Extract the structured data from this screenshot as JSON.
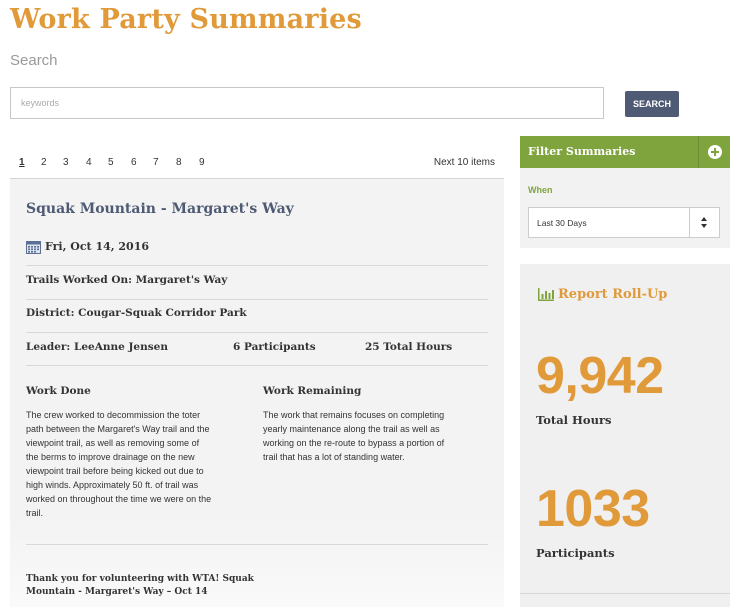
{
  "header": {
    "title": "Work Party Summaries"
  },
  "search": {
    "label": "Search",
    "placeholder": "keywords",
    "button_label": "SEARCH"
  },
  "pagination": {
    "pages": [
      "1",
      "2",
      "3",
      "4",
      "5",
      "6",
      "7",
      "8",
      "9"
    ],
    "current": "1",
    "next_label": "Next 10 items"
  },
  "summary": {
    "title": "Squak Mountain - Margaret's Way",
    "date": "Fri, Oct 14, 2016",
    "trails": "Trails Worked On: Margaret's Way",
    "district": "District: Cougar-Squak Corridor Park",
    "leader": "Leader: LeeAnne Jensen",
    "participants": "6 Participants",
    "hours": "25 Total Hours",
    "work_done_heading": "Work Done",
    "work_done_lines": [
      "The crew worked to decommission the toter",
      "path between the Margaret's Way trail and the",
      "viewpoint trail, as well as removing some of",
      "the berms to improve drainage on the new",
      "viewpoint trail before being kicked out due to",
      "high winds. Approximately 50 ft. of trail was",
      "worked on throughout the time we were on the",
      "trail."
    ],
    "work_remaining_heading": "Work Remaining",
    "work_remaining_lines": [
      "The work that remains focuses on completing",
      "yearly maintenance along the trail as well as",
      "working on the re-route to bypass a portion of",
      "trail that has a lot of standing water."
    ],
    "thanks_lines": [
      "Thank you for volunteering with WTA! Squak",
      "Mountain - Margaret's Way – Oct 14"
    ]
  },
  "filter": {
    "title": "Filter Summaries",
    "when_label": "When",
    "selected_option": "Last 30 Days"
  },
  "rollup": {
    "title": "Report Roll-Up",
    "total_hours_value": "9,942",
    "total_hours_label": "Total Hours",
    "participants_value": "1033",
    "participants_label": "Participants"
  },
  "colors": {
    "title_orange": "#e09a3a",
    "filter_green": "#80a43d",
    "button_slate": "#4f5b74"
  }
}
